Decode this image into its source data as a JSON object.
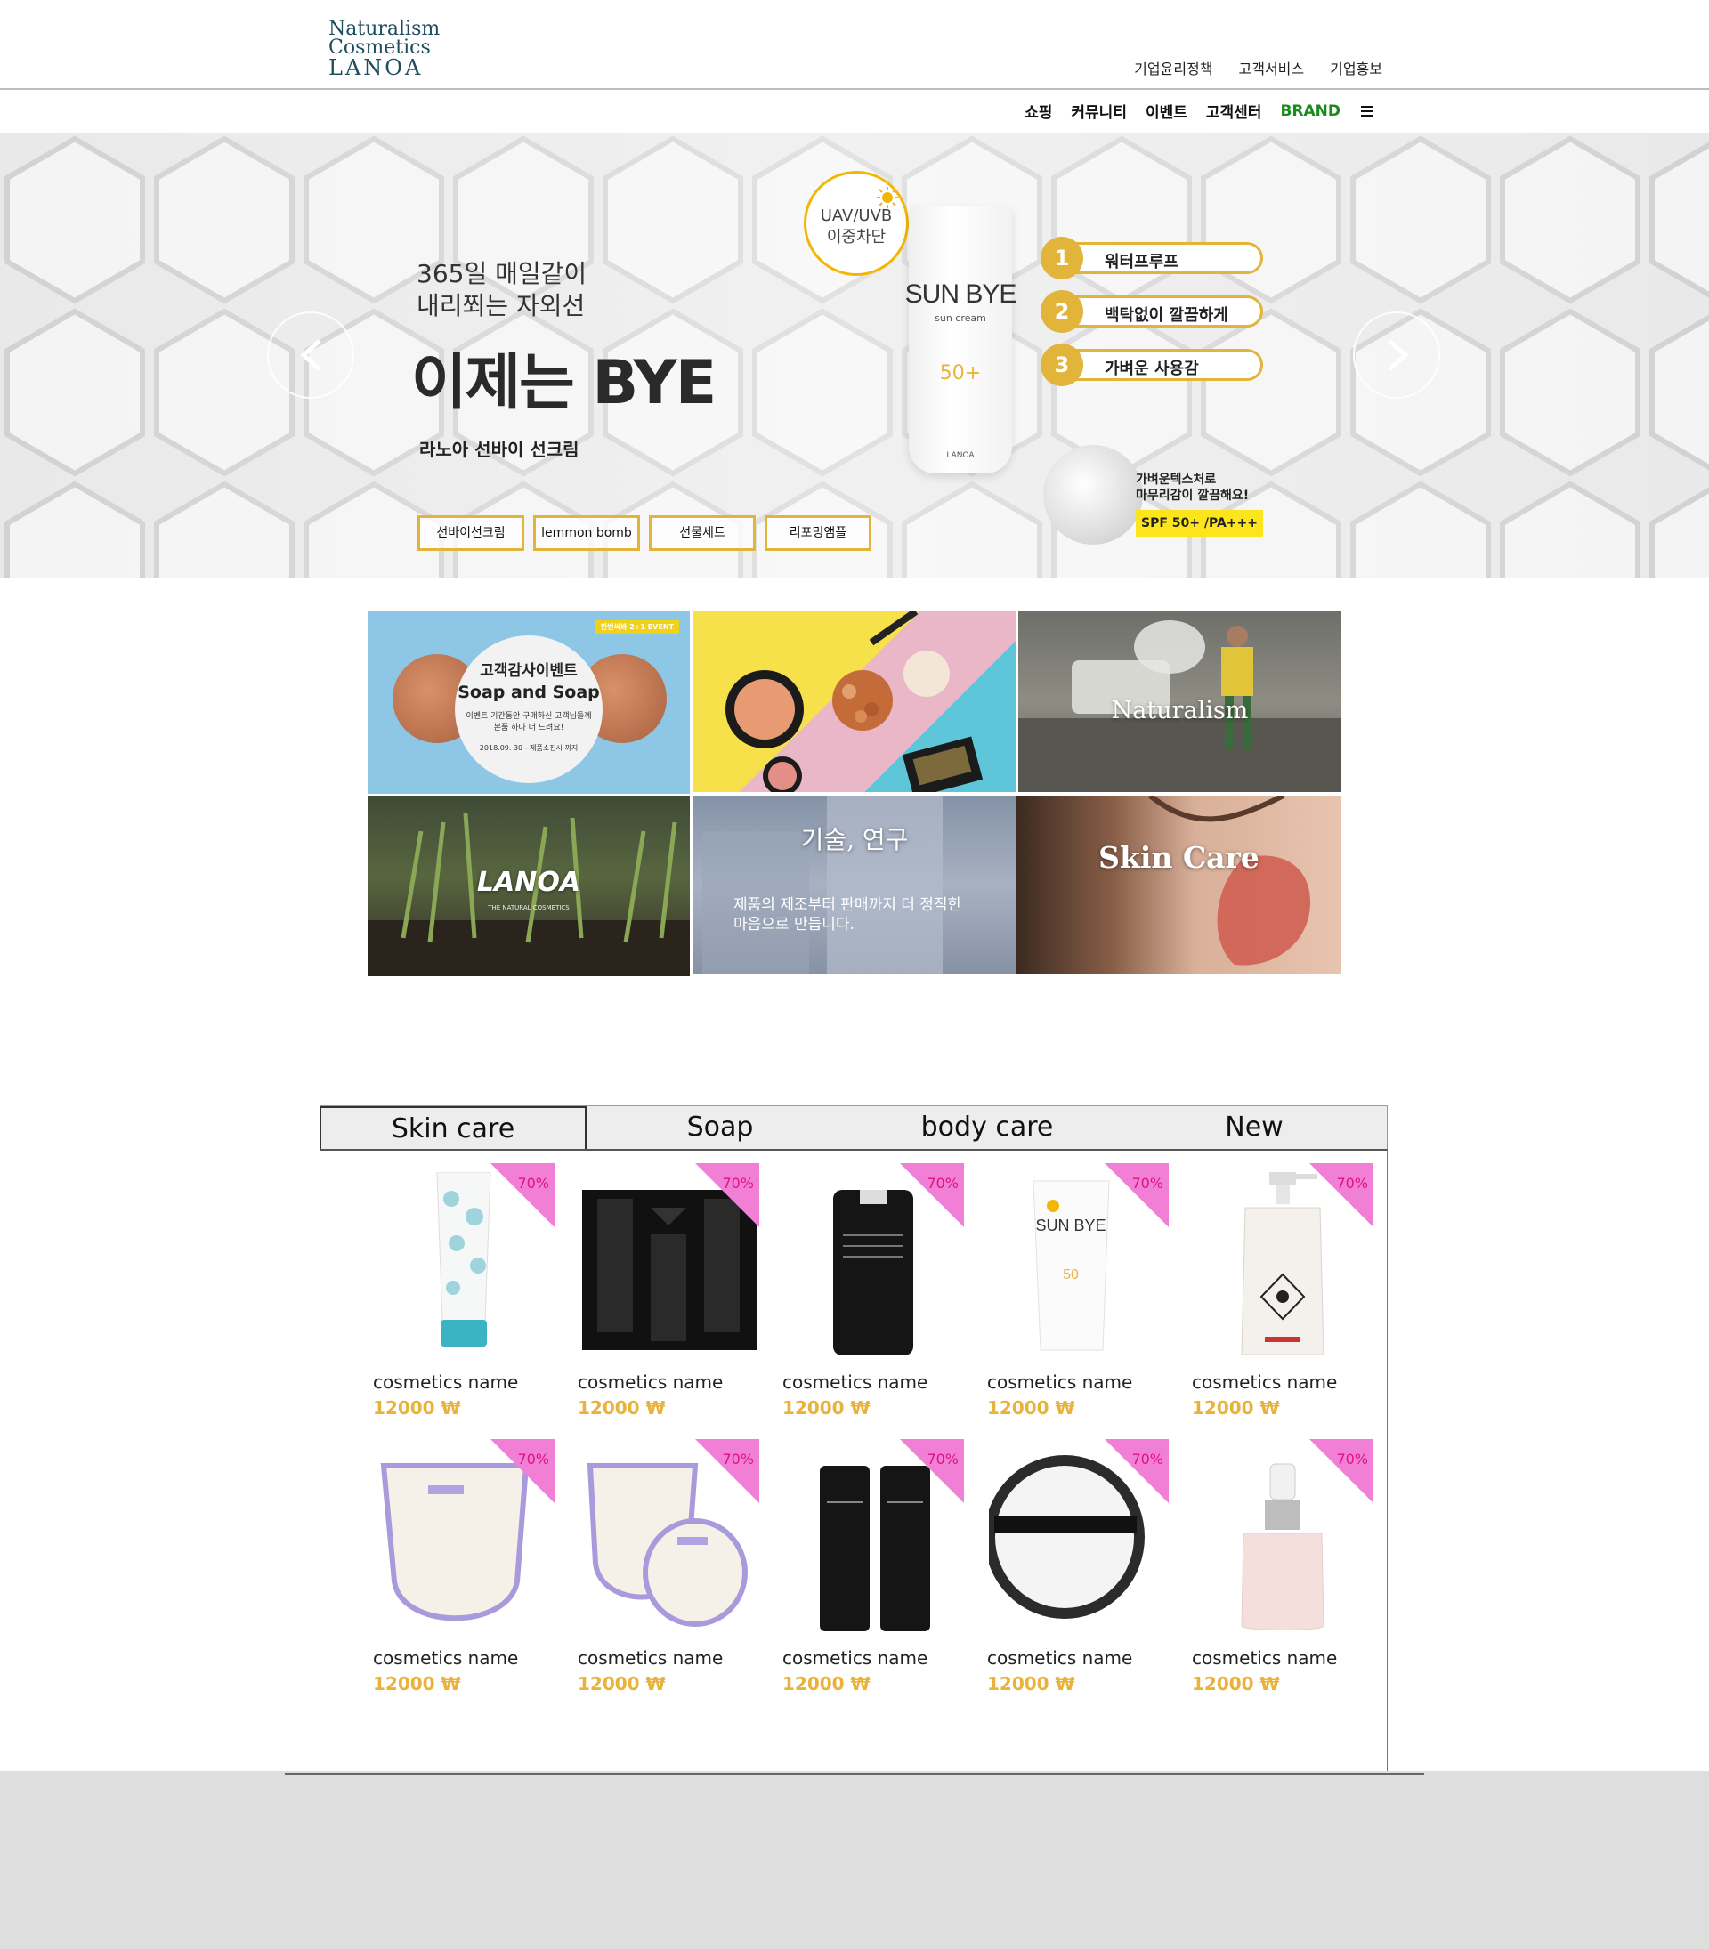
{
  "header": {
    "logo": {
      "line1": "Naturalism",
      "line2": "Cosmetics",
      "line3": "LANOA"
    },
    "top_links": [
      "기업윤리정책",
      "고객서비스",
      "기업홍보"
    ],
    "main_nav": [
      "쇼핑",
      "커뮤니티",
      "이벤트",
      "고객센터"
    ],
    "brand_label": "BRAND",
    "brand_color": "#1a8a1a"
  },
  "hero": {
    "subtitle_line1": "365일 매일같이",
    "subtitle_line2": "내리쬐는 자외선",
    "title": "이제는 BYE",
    "product_label": "라노아 선바이 선크림",
    "buttons": [
      "선바이선크림",
      "lemmon bomb",
      "선물세트",
      "리포밍앰플"
    ],
    "uv_badge": {
      "line1": "UAV/UVB",
      "line2": "이중차단"
    },
    "tube": {
      "brand": "SUN BYE",
      "sub": "sun cream",
      "spf": "50+",
      "maker": "LANOA"
    },
    "features": [
      {
        "num": "1",
        "text": "워터프루프"
      },
      {
        "num": "2",
        "text": "백탁없이 깔끔하게"
      },
      {
        "num": "3",
        "text": "가벼운 사용감"
      }
    ],
    "cream_text_line1": "가벼운텍스처로",
    "cream_text_line2": "마무리감이 깔끔해요!",
    "spf_tag": "SPF 50+ /PA+++",
    "accent_color": "#e3b43a"
  },
  "grid": {
    "event": {
      "badge": "한번써봐 2+1 EVENT",
      "title": "고객감사이벤트",
      "subtitle": "Soap and Soap",
      "desc_line1": "이벤트 기간동안 구매하신 고객님들께",
      "desc_line2": "본품 하나 더 드려요!",
      "date": "2018.09. 30 - 제품소진시 까지"
    },
    "naturalism": "Naturalism",
    "lanoa": "LANOA",
    "lanoa_tag": "THE NATURAL COSMETICS",
    "research": "기술, 연구",
    "research_desc_line1": "제품의 제조부터 판매까지 더 정직한",
    "research_desc_line2": "마음으로 만듭니다.",
    "skincare": "Skin Care"
  },
  "tabs": [
    "Skin care",
    "Soap",
    "body care",
    "New"
  ],
  "products": [
    {
      "name": "cosmetics name",
      "price": "12000 ₩",
      "discount": "70%",
      "icon": "cleansing-foam-tube"
    },
    {
      "name": "cosmetics name",
      "price": "12000 ₩",
      "discount": "70%",
      "icon": "gift-set-box"
    },
    {
      "name": "cosmetics name",
      "price": "12000 ₩",
      "discount": "70%",
      "icon": "essential-cream-bottle"
    },
    {
      "name": "cosmetics name",
      "price": "12000 ₩",
      "discount": "70%",
      "icon": "sun-cream-tube"
    },
    {
      "name": "cosmetics name",
      "price": "12000 ₩",
      "discount": "70%",
      "icon": "scalp-therapy-pump"
    },
    {
      "name": "cosmetics name",
      "price": "12000 ₩",
      "discount": "70%",
      "icon": "exfoliating-mitt"
    },
    {
      "name": "cosmetics name",
      "price": "12000 ₩",
      "discount": "70%",
      "icon": "mitt-and-pad"
    },
    {
      "name": "cosmetics name",
      "price": "12000 ₩",
      "discount": "70%",
      "icon": "toner-emulsion-pair"
    },
    {
      "name": "cosmetics name",
      "price": "12000 ₩",
      "discount": "70%",
      "icon": "cleansing-rub-pad"
    },
    {
      "name": "cosmetics name",
      "price": "12000 ₩",
      "discount": "70%",
      "icon": "ampoule-dropper"
    }
  ],
  "colors": {
    "price": "#e9b33b",
    "ribbon": "#f27fd6",
    "ribbon_text": "#e0127f"
  }
}
